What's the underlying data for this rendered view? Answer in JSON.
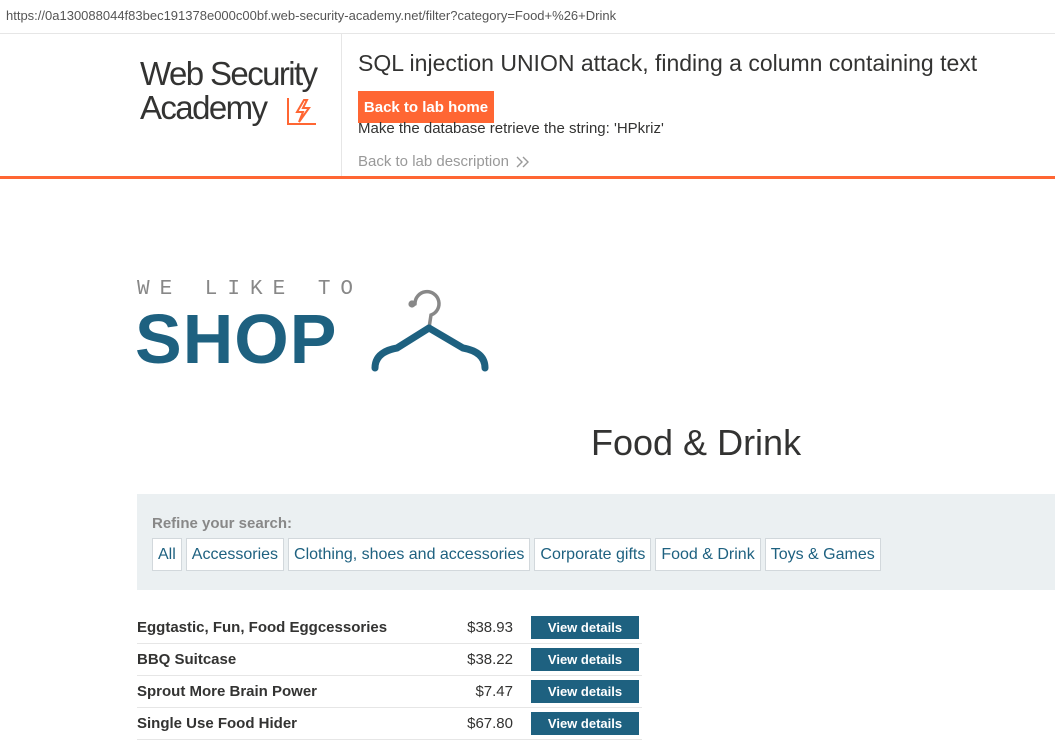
{
  "browser": {
    "url": "https://0a130088044f83bec191378e000c00bf.web-security-academy.net/filter?category=Food+%26+Drink"
  },
  "lab_header": {
    "logo_line1": "Web Security",
    "logo_line2": "Academy",
    "title": "SQL injection UNION attack, finding a column containing text",
    "back_home_label": "Back to lab home",
    "goal": "Make the database retrieve the string: 'HPkriz'",
    "back_description_label": "Back to lab description",
    "accent_color": "#ff6633"
  },
  "shop_logo": {
    "tagline": "WE LIKE TO",
    "word": "SHOP",
    "brand_color": "#1e6180"
  },
  "category": {
    "title": "Food & Drink"
  },
  "filters": {
    "label": "Refine your search:",
    "items": [
      {
        "label": "All"
      },
      {
        "label": "Accessories"
      },
      {
        "label": "Clothing, shoes and accessories"
      },
      {
        "label": "Corporate gifts"
      },
      {
        "label": "Food & Drink"
      },
      {
        "label": "Toys & Games"
      }
    ]
  },
  "products": [
    {
      "name": "Eggtastic, Fun, Food Eggcessories",
      "price": "$38.93",
      "button": "View details"
    },
    {
      "name": "BBQ Suitcase",
      "price": "$38.22",
      "button": "View details"
    },
    {
      "name": "Sprout More Brain Power",
      "price": "$7.47",
      "button": "View details"
    },
    {
      "name": "Single Use Food Hider",
      "price": "$67.80",
      "button": "View details"
    }
  ]
}
